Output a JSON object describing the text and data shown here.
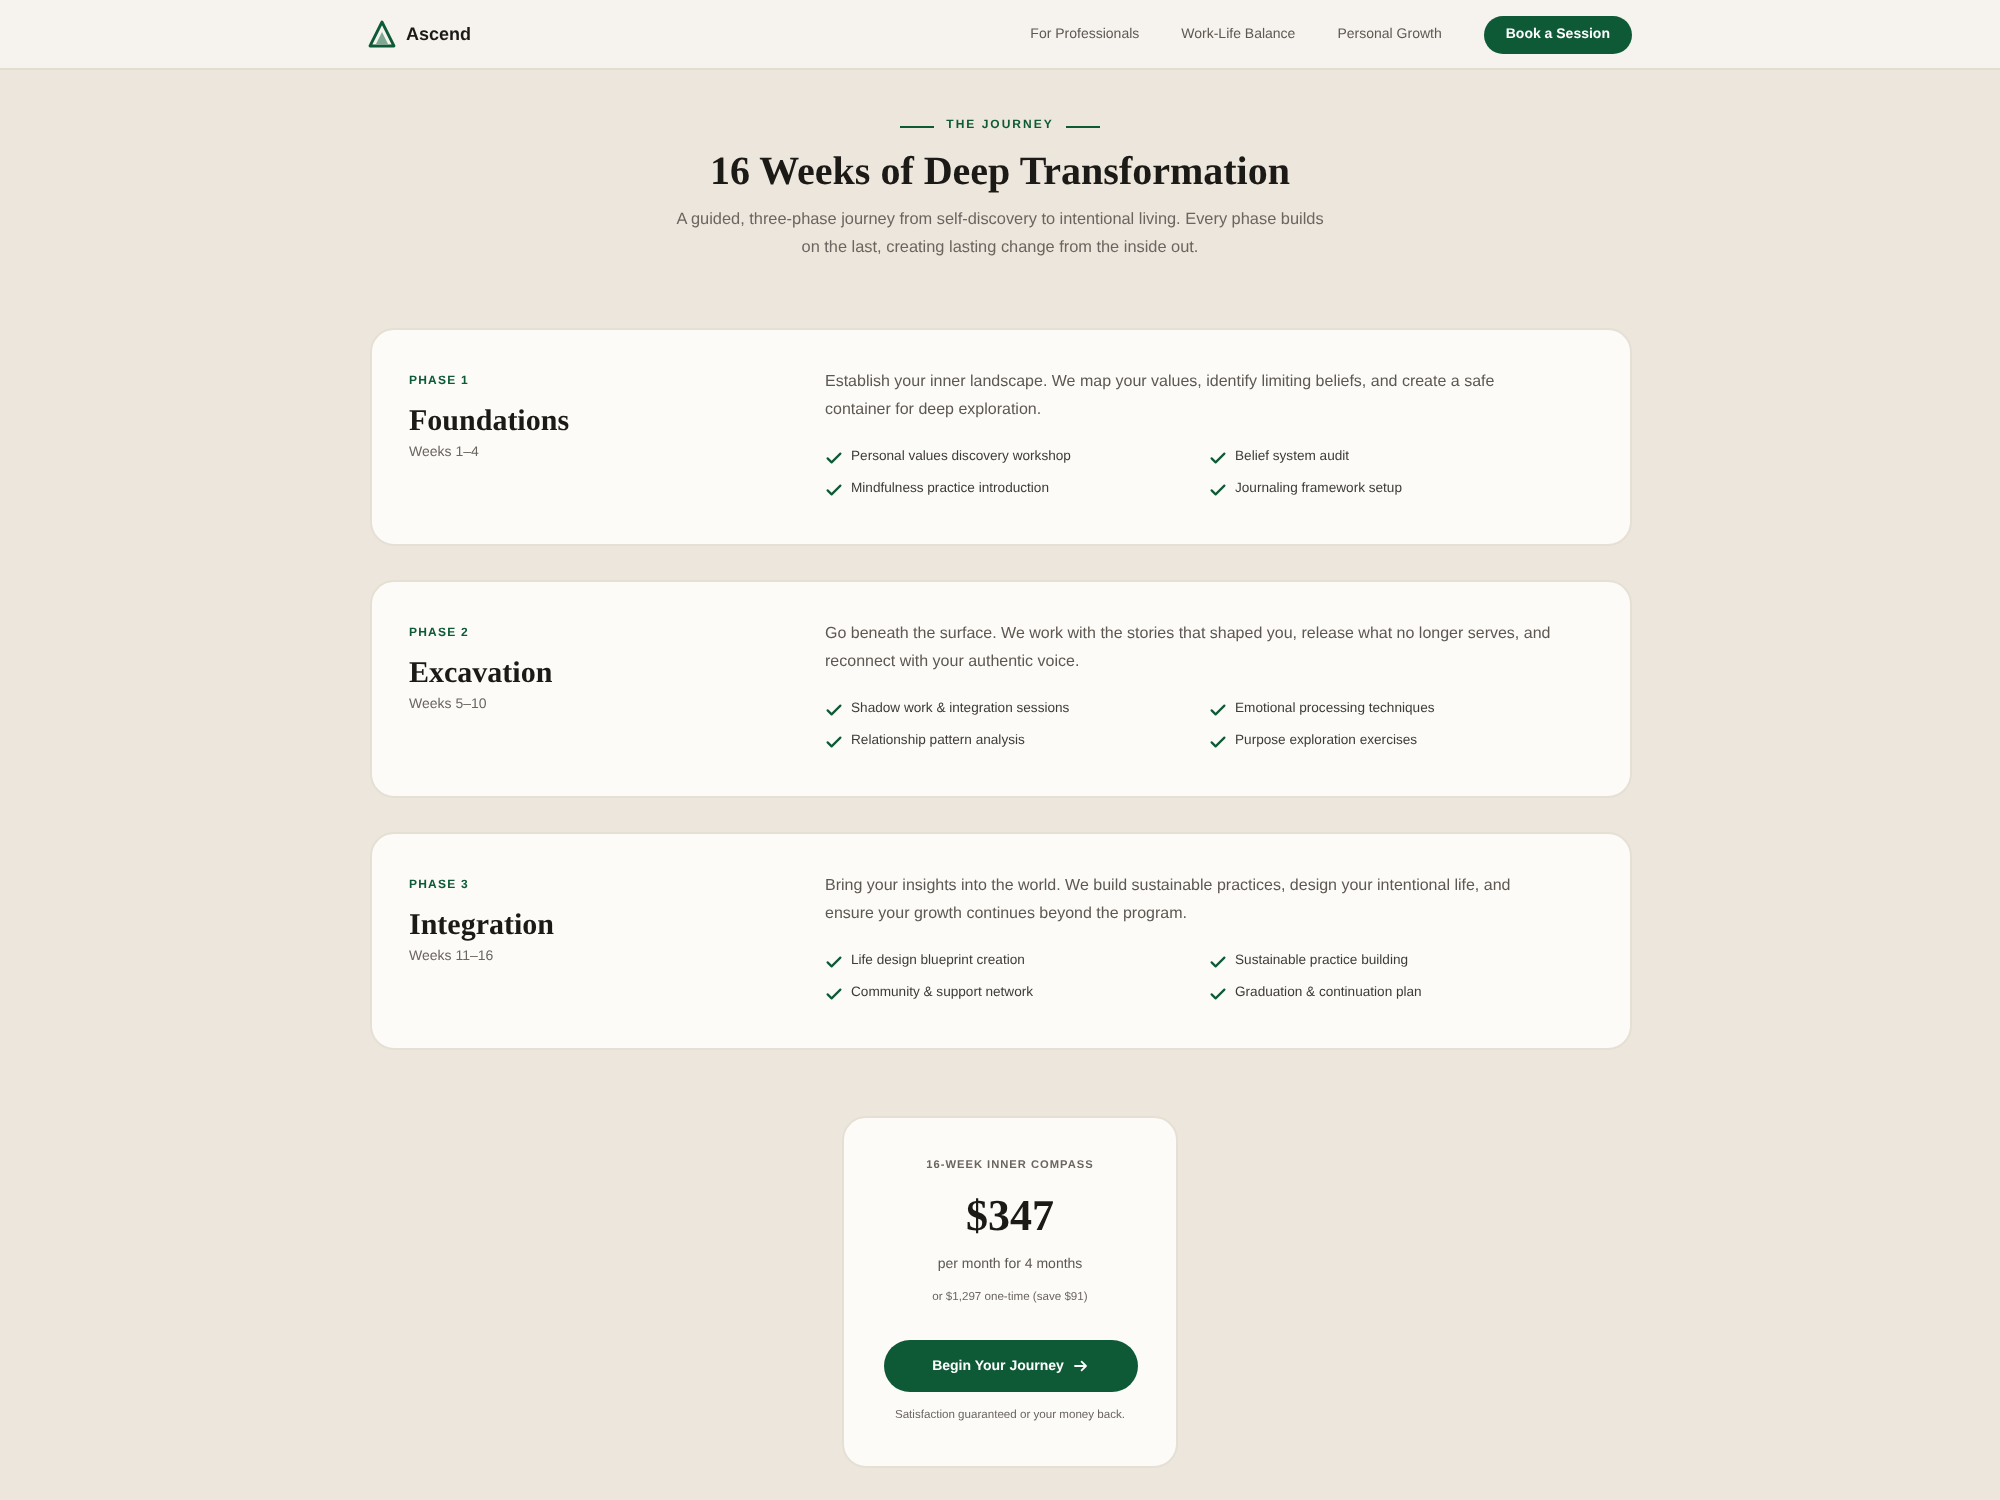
{
  "header": {
    "logo": "Ascend",
    "nav": [
      "For Professionals",
      "Work-Life Balance",
      "Personal Growth"
    ],
    "cta": "Book a Session"
  },
  "intro": {
    "eyebrow": "THE JOURNEY",
    "title": "16 Weeks of Deep Transformation",
    "subtitle": "A guided, three-phase journey from self-discovery to intentional living. Every phase builds on the last, creating lasting change from the inside out."
  },
  "phases": [
    {
      "label": "PHASE 1",
      "title": "Foundations",
      "weeks": "Weeks 1–4",
      "description": "Establish your inner landscape. We map your values, identify limiting beliefs, and create a safe container for deep exploration.",
      "items": [
        "Personal values discovery workshop",
        "Belief system audit",
        "Mindfulness practice introduction",
        "Journaling framework setup"
      ]
    },
    {
      "label": "PHASE 2",
      "title": "Excavation",
      "weeks": "Weeks 5–10",
      "description": "Go beneath the surface. We work with the stories that shaped you, release what no longer serves, and reconnect with your authentic voice.",
      "items": [
        "Shadow work & integration sessions",
        "Emotional processing techniques",
        "Relationship pattern analysis",
        "Purpose exploration exercises"
      ]
    },
    {
      "label": "PHASE 3",
      "title": "Integration",
      "weeks": "Weeks 11–16",
      "description": "Bring your insights into the world. We build sustainable practices, design your intentional life, and ensure your growth continues beyond the program.",
      "items": [
        "Life design blueprint creation",
        "Sustainable practice building",
        "Community & support network",
        "Graduation & continuation plan"
      ]
    }
  ],
  "pricing": {
    "eyebrow": "16-WEEK INNER COMPASS",
    "price": "$347",
    "period": "per month for 4 months",
    "alternative": "or $1,297 one-time (save $91)",
    "button": "Begin Your Journey",
    "note": "Satisfaction guaranteed or your money back."
  }
}
